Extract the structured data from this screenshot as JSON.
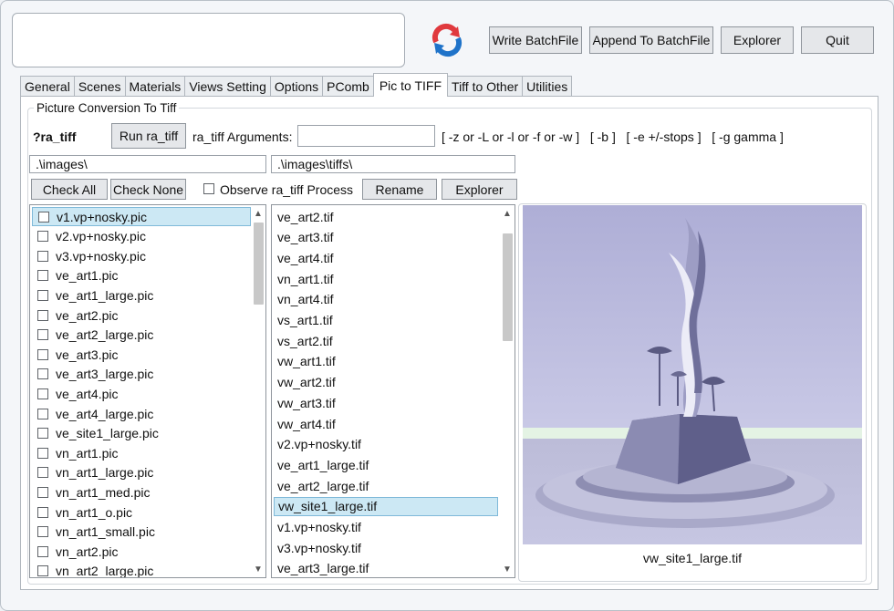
{
  "toolbar": {
    "write_batch_label": "Write BatchFile",
    "append_batch_label": "Append To BatchFile",
    "explorer_label": "Explorer",
    "quit_label": "Quit"
  },
  "tabs": [
    "General",
    "Scenes",
    "Materials",
    "Views Setting",
    "Options",
    "PComb",
    "Pic to TIFF",
    "Tiff to Other",
    "Utilities"
  ],
  "active_tab": "Pic to TIFF",
  "panel": {
    "group_title": "Picture Conversion To Tiff",
    "ra_tiff_status": "?ra_tiff",
    "run_button": "Run ra_tiff",
    "args_label": "ra_tiff Arguments:",
    "args_value": "",
    "args_hint": "[ -z or -L or -l or -f or -w ]   [ -b ]   [ -e +/-stops ]   [ -g gamma ]",
    "source_dir": ".\\images\\",
    "target_dir": ".\\images\\tiffs\\",
    "check_all": "Check All",
    "check_none": "Check None",
    "observe_label": "Observe ra_tiff Process",
    "observe_checked": false,
    "rename_button": "Rename",
    "explorer_button": "Explorer"
  },
  "pic_files": [
    "v1.vp+nosky.pic",
    "v2.vp+nosky.pic",
    "v3.vp+nosky.pic",
    "ve_art1.pic",
    "ve_art1_large.pic",
    "ve_art2.pic",
    "ve_art2_large.pic",
    "ve_art3.pic",
    "ve_art3_large.pic",
    "ve_art4.pic",
    "ve_art4_large.pic",
    "ve_site1_large.pic",
    "vn_art1.pic",
    "vn_art1_large.pic",
    "vn_art1_med.pic",
    "vn_art1_o.pic",
    "vn_art1_small.pic",
    "vn_art2.pic",
    "vn_art2_large.pic"
  ],
  "pic_selected_index": 0,
  "tif_files": [
    "ve_art2.tif",
    "ve_art3.tif",
    "ve_art4.tif",
    "vn_art1.tif",
    "vn_art4.tif",
    "vs_art1.tif",
    "vs_art2.tif",
    "vw_art1.tif",
    "vw_art2.tif",
    "vw_art3.tif",
    "vw_art4.tif",
    "v2.vp+nosky.tif",
    "ve_art1_large.tif",
    "ve_art2_large.tif",
    "vw_site1_large.tif",
    "v1.vp+nosky.tif",
    "v3.vp+nosky.tif",
    "ve_art3_large.tif"
  ],
  "tif_selected_index": 14,
  "preview_caption": "vw_site1_large.tif",
  "colors": {
    "selection_bg": "#cce8f4",
    "selection_border": "#7fb9d9",
    "icon_red": "#e0393e",
    "icon_blue": "#1f73c9"
  }
}
